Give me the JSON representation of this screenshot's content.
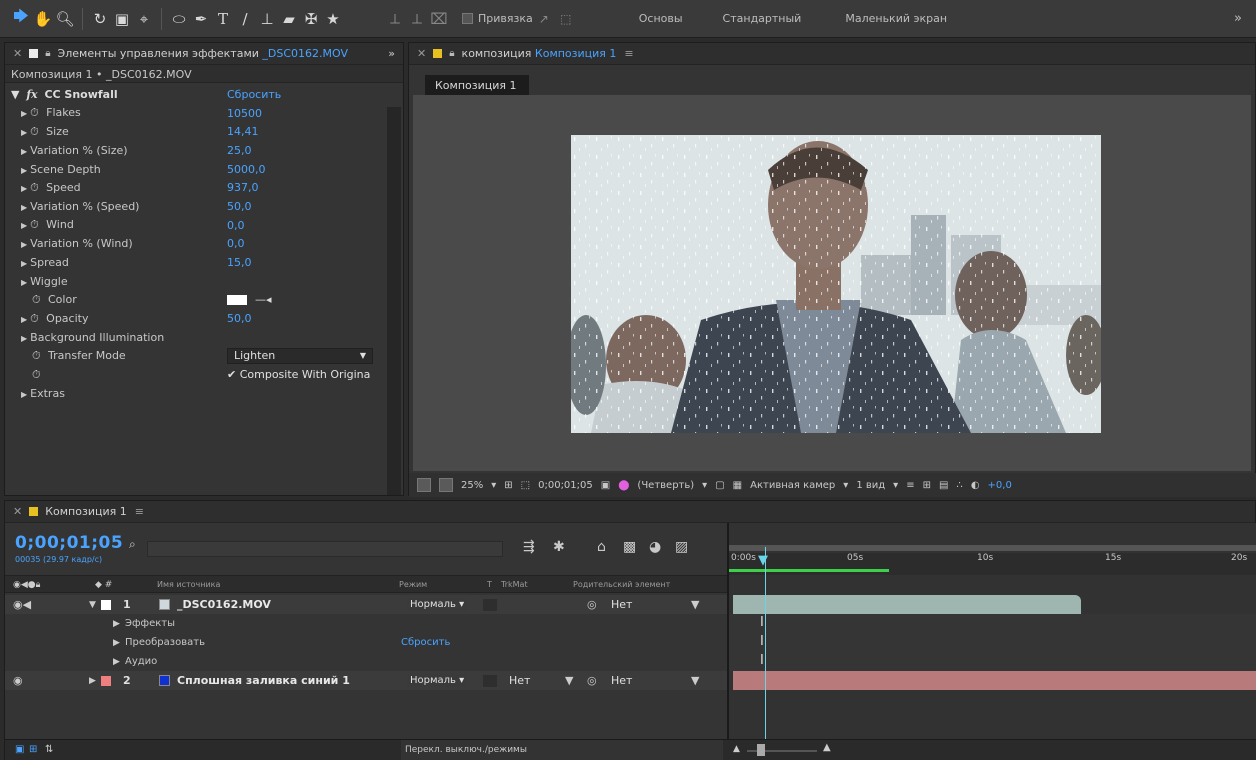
{
  "toolbar": {
    "snap_label": "Привязка",
    "workspaces": [
      "Основы",
      "Стандартный",
      "Маленький экран"
    ],
    "overflow": "»"
  },
  "effects_panel": {
    "title": "Элементы управления эффектами",
    "title_file": "_DSC0162.MOV",
    "overflow": "»",
    "subtitle": "Композиция 1 • _DSC0162.MOV",
    "effect_name": "CC Snowfall",
    "reset_label": "Сбросить",
    "properties": [
      {
        "name": "Flakes",
        "value": "10500",
        "stopwatch": true,
        "expand": true
      },
      {
        "name": "Size",
        "value": "14,41",
        "stopwatch": true,
        "expand": true
      },
      {
        "name": "Variation % (Size)",
        "value": "25,0",
        "stopwatch": false,
        "expand": true
      },
      {
        "name": "Scene Depth",
        "value": "5000,0",
        "stopwatch": false,
        "expand": true
      },
      {
        "name": "Speed",
        "value": "937,0",
        "stopwatch": true,
        "expand": true
      },
      {
        "name": "Variation % (Speed)",
        "value": "50,0",
        "stopwatch": false,
        "expand": true
      },
      {
        "name": "Wind",
        "value": "0,0",
        "stopwatch": true,
        "expand": true
      },
      {
        "name": "Variation % (Wind)",
        "value": "0,0",
        "stopwatch": false,
        "expand": true
      },
      {
        "name": "Spread",
        "value": "15,0",
        "stopwatch": false,
        "expand": true
      },
      {
        "name": "Wiggle",
        "value": "",
        "stopwatch": false,
        "expand": true
      },
      {
        "name": "Color",
        "value": "",
        "stopwatch": true,
        "expand": false,
        "color": "#ffffff"
      },
      {
        "name": "Opacity",
        "value": "50,0",
        "stopwatch": true,
        "expand": true
      },
      {
        "name": "Background Illumination",
        "value": "",
        "stopwatch": false,
        "expand": true
      },
      {
        "name": "Transfer Mode",
        "value": "",
        "stopwatch": true,
        "expand": false
      },
      {
        "name": "",
        "value": "",
        "stopwatch": true,
        "expand": false
      },
      {
        "name": "Extras",
        "value": "",
        "stopwatch": false,
        "expand": true
      }
    ],
    "transfer_mode_value": "Lighten",
    "composite_label": "Composite With Origina"
  },
  "composition_panel": {
    "title_prefix": "композиция",
    "title_name": "Композиция 1",
    "tab": "Композиция 1",
    "zoom": "25%",
    "timecode": "0;00;01;05",
    "resolution": "(Четверть)",
    "camera": "Активная камер",
    "views": "1 вид",
    "exposure": "+0,0"
  },
  "timeline": {
    "tab": "Композиция 1",
    "timecode": "0;00;01;05",
    "frames_info": "00035 (29.97 кадр/с)",
    "columns": {
      "source_name": "Имя источника",
      "mode": "Режим",
      "t": "T",
      "trkmat": "TrkMat",
      "parent": "Родительский элемент"
    },
    "layers": [
      {
        "num": "1",
        "name": "_DSC0162.MOV",
        "mode": "Нормаль",
        "parent": "Нет",
        "label_color": "#ffffff",
        "icon_color": "#cfd8dc"
      },
      {
        "num": "2",
        "name": "Сплошная заливка синий 1",
        "mode": "Нормаль",
        "trkmat": "Нет",
        "parent": "Нет",
        "label_color": "#f08080",
        "icon_color": "#1030d0"
      }
    ],
    "sub_rows": [
      {
        "name": "Эффекты"
      },
      {
        "name": "Преобразовать",
        "value": "Сбросить"
      },
      {
        "name": "Аудио"
      }
    ],
    "ruler_labels": [
      "0:00s",
      "05s",
      "10s",
      "15s",
      "20s"
    ],
    "bottom_label": "Перекл. выключ./режимы",
    "layer1_bar_color": "#9fb5b0",
    "layer2_bar_color": "#b87a7a"
  }
}
